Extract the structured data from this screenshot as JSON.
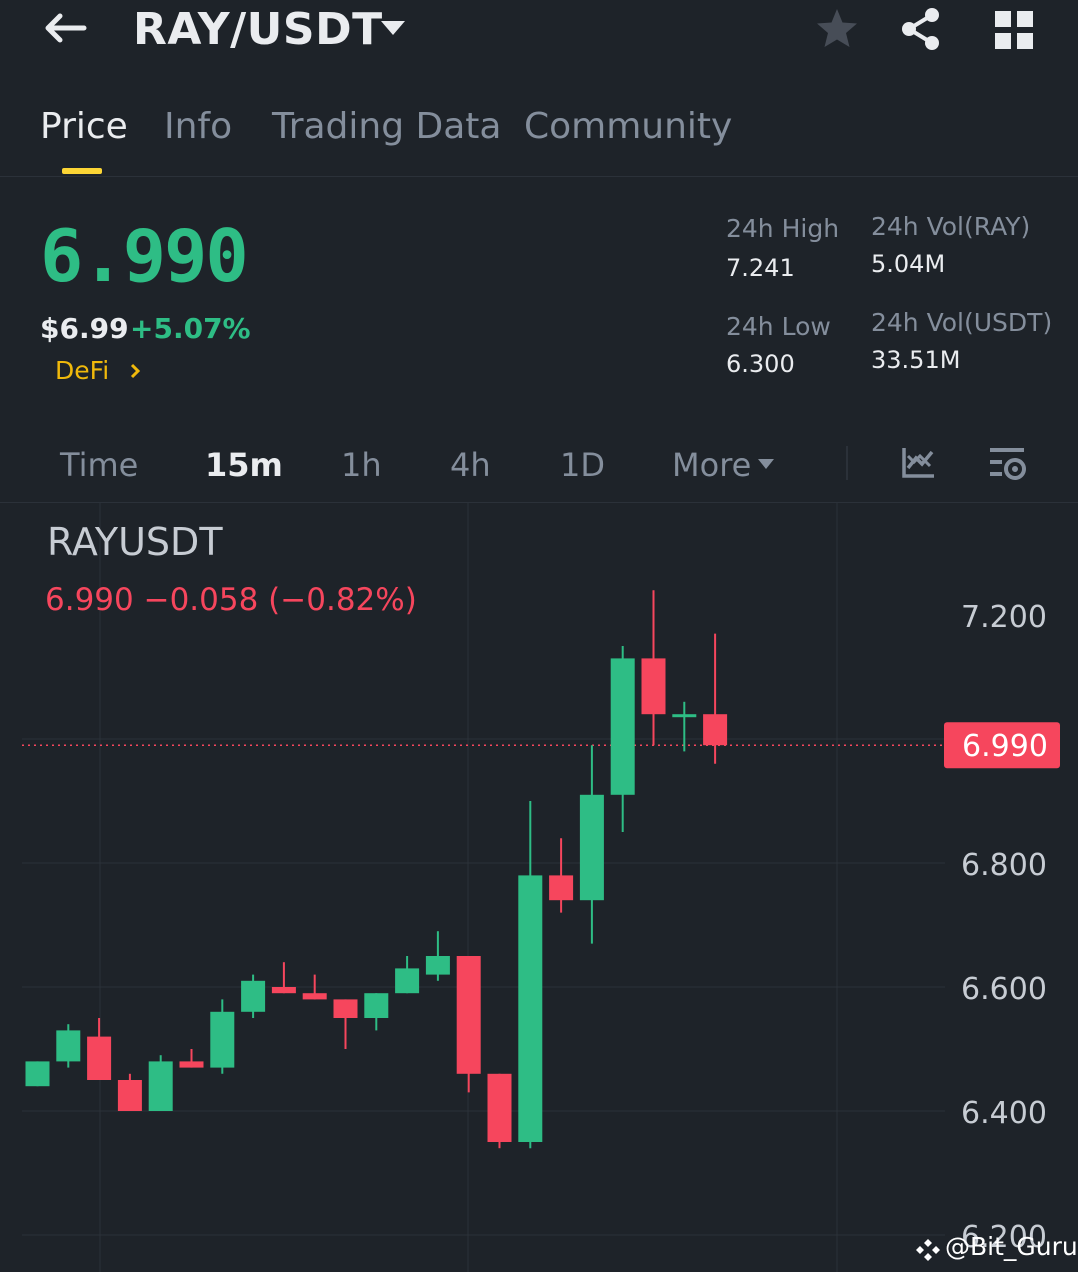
{
  "header": {
    "pair": "RAY/USDT",
    "icons": [
      "back-arrow-icon",
      "caret-down-icon",
      "star-icon",
      "share-icon",
      "grid-icon"
    ]
  },
  "tabs": [
    {
      "label": "Price",
      "active": true
    },
    {
      "label": "Info",
      "active": false
    },
    {
      "label": "Trading Data",
      "active": false
    },
    {
      "label": "Community",
      "active": false
    }
  ],
  "ticker": {
    "last_price": "6.990",
    "usd_price": "$6.99",
    "change_pct": "+5.07%",
    "tag": "DeFi",
    "high_label": "24h High",
    "high_value": "7.241",
    "low_label": "24h Low",
    "low_value": "6.300",
    "vol_base_label": "24h Vol(RAY)",
    "vol_base_value": "5.04M",
    "vol_quote_label": "24h Vol(USDT)",
    "vol_quote_value": "33.51M"
  },
  "intervals": [
    {
      "label": "Time",
      "active": false
    },
    {
      "label": "15m",
      "active": true
    },
    {
      "label": "1h",
      "active": false
    },
    {
      "label": "4h",
      "active": false
    },
    {
      "label": "1D",
      "active": false
    },
    {
      "label": "More",
      "active": false
    }
  ],
  "colors": {
    "up": "#2ebd85",
    "down": "#f6465d",
    "accent": "#fcd535",
    "bg": "#1e2329"
  },
  "chart_info": {
    "symbol": "RAYUSDT",
    "summary": "6.990  −0.058 (−0.82%)"
  },
  "watermark": "@Bit_Guru",
  "chart_data": {
    "type": "candlestick",
    "ylim": [
      6.2,
      7.2
    ],
    "yticks": [
      7.2,
      6.8,
      6.6,
      6.4,
      6.2
    ],
    "ytick_labels": [
      "7.200",
      "6.800",
      "6.600",
      "6.400",
      "6.200"
    ],
    "current_price": 6.99,
    "current_price_label": "6.990",
    "candles": [
      {
        "o": 6.44,
        "h": 6.48,
        "l": 6.44,
        "c": 6.48
      },
      {
        "o": 6.48,
        "h": 6.54,
        "l": 6.47,
        "c": 6.53
      },
      {
        "o": 6.52,
        "h": 6.55,
        "l": 6.45,
        "c": 6.45
      },
      {
        "o": 6.45,
        "h": 6.46,
        "l": 6.4,
        "c": 6.4
      },
      {
        "o": 6.4,
        "h": 6.49,
        "l": 6.4,
        "c": 6.48
      },
      {
        "o": 6.48,
        "h": 6.5,
        "l": 6.47,
        "c": 6.47
      },
      {
        "o": 6.47,
        "h": 6.58,
        "l": 6.46,
        "c": 6.56
      },
      {
        "o": 6.56,
        "h": 6.62,
        "l": 6.55,
        "c": 6.61
      },
      {
        "o": 6.6,
        "h": 6.64,
        "l": 6.59,
        "c": 6.59
      },
      {
        "o": 6.59,
        "h": 6.62,
        "l": 6.58,
        "c": 6.58
      },
      {
        "o": 6.58,
        "h": 6.58,
        "l": 6.5,
        "c": 6.55
      },
      {
        "o": 6.55,
        "h": 6.59,
        "l": 6.53,
        "c": 6.59
      },
      {
        "o": 6.59,
        "h": 6.65,
        "l": 6.59,
        "c": 6.63
      },
      {
        "o": 6.62,
        "h": 6.69,
        "l": 6.61,
        "c": 6.65
      },
      {
        "o": 6.65,
        "h": 6.65,
        "l": 6.43,
        "c": 6.46
      },
      {
        "o": 6.46,
        "h": 6.46,
        "l": 6.34,
        "c": 6.35
      },
      {
        "o": 6.35,
        "h": 6.9,
        "l": 6.34,
        "c": 6.78
      },
      {
        "o": 6.78,
        "h": 6.84,
        "l": 6.72,
        "c": 6.74
      },
      {
        "o": 6.74,
        "h": 6.99,
        "l": 6.67,
        "c": 6.91
      },
      {
        "o": 6.91,
        "h": 7.15,
        "l": 6.85,
        "c": 7.13
      },
      {
        "o": 7.13,
        "h": 7.24,
        "l": 6.99,
        "c": 7.04
      },
      {
        "o": 7.04,
        "h": 7.06,
        "l": 6.98,
        "c": 7.04
      },
      {
        "o": 7.04,
        "h": 7.17,
        "l": 6.96,
        "c": 6.99
      }
    ]
  }
}
